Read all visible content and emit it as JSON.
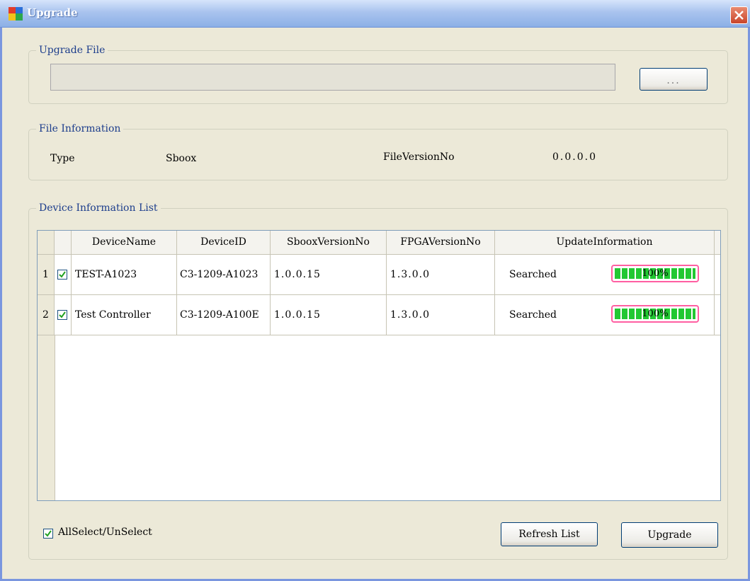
{
  "window": {
    "title": "Upgrade"
  },
  "upgrade_file": {
    "legend": "Upgrade File",
    "path_value": "",
    "browse_label": "..."
  },
  "file_information": {
    "legend": "File Information",
    "type_label": "Type",
    "type_value": "Sboox",
    "version_label": "FileVersionNo",
    "version_value": "0.0.0.0"
  },
  "device_list": {
    "legend": "Device Information List",
    "columns": [
      "DeviceName",
      "DeviceID",
      "SbooxVersionNo",
      "FPGAVersionNo",
      "UpdateInformation"
    ],
    "rows": [
      {
        "index": "1",
        "checked": true,
        "device_name": "TEST-A1023",
        "device_id": "C3-1209-A1023",
        "sboox_version": "1.0.0.15",
        "fpga_version": "1.3.0.0",
        "status": "Searched",
        "progress_text": "100%",
        "progress": 1.0
      },
      {
        "index": "2",
        "checked": true,
        "device_name": "Test Controller",
        "device_id": "C3-1209-A100E",
        "sboox_version": "1.0.0.15",
        "fpga_version": "1.3.0.0",
        "status": "Searched",
        "progress_text": "100%",
        "progress": 1.0
      }
    ]
  },
  "footer": {
    "select_all_label": "AllSelect/UnSelect",
    "select_all_checked": true,
    "refresh_label": "Refresh List",
    "upgrade_label": "Upgrade"
  },
  "colors": {
    "title_gradient_top": "#d6e4fb",
    "close_button": "#c9452a",
    "progress_fill": "#22c832",
    "progress_border": "#ff5fa2"
  },
  "icons": {
    "app": "app-icon",
    "close": "close-icon",
    "check": "check-icon"
  }
}
